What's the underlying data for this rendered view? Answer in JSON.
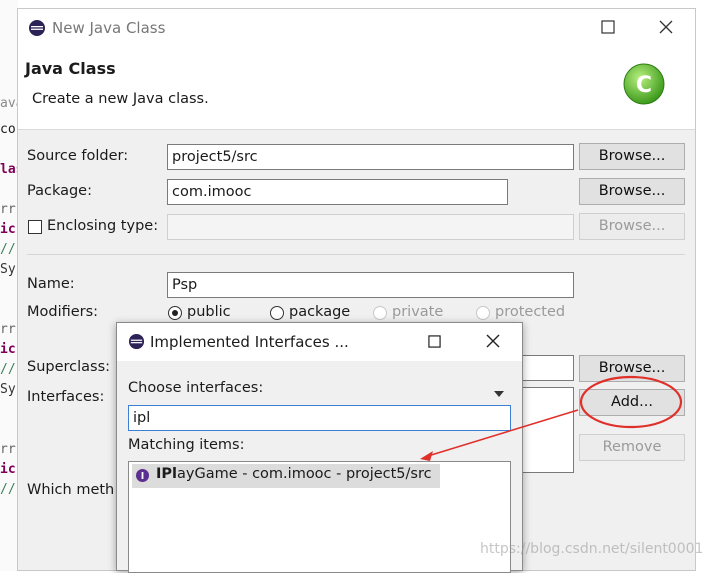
{
  "editor_fragments": [
    "ava",
    "co",
    "las",
    "rr",
    "ic",
    "//",
    "Sy",
    "rr",
    "ic",
    "//",
    "Sy",
    "rr",
    "ic",
    "//"
  ],
  "main_dialog": {
    "title": "New Java Class",
    "heading": "Java Class",
    "description": "Create a new Java class.",
    "source_folder": {
      "label": "Source folder:",
      "value": "project5/src",
      "button": "Browse..."
    },
    "package": {
      "label": "Package:",
      "value": "com.imooc",
      "button": "Browse..."
    },
    "enclosing": {
      "label": "Enclosing type:",
      "button": "Browse..."
    },
    "name": {
      "label": "Name:",
      "value": "Psp"
    },
    "modifiers": {
      "label": "Modifiers:",
      "options": [
        "public",
        "package",
        "private",
        "protected"
      ],
      "selected": "public"
    },
    "superclass": {
      "label": "Superclass:",
      "button": "Browse..."
    },
    "interfaces": {
      "label": "Interfaces:",
      "add_button": "Add...",
      "remove_button": "Remove"
    },
    "which_methods": "Which meth"
  },
  "impl_dialog": {
    "title": "Implemented Interfaces ...",
    "choose_label": "Choose interfaces:",
    "search_value": "ipl",
    "matching_label": "Matching items:",
    "items": [
      {
        "match": "IPl",
        "rest": "ayGame - com.imooc - project5/src"
      }
    ]
  },
  "watermark": "https://blog.csdn.net/silent0001",
  "colors": {
    "annotation": "#e0302a",
    "interface_icon": "#5b2f8f",
    "class_icon": "#5cb82e"
  }
}
